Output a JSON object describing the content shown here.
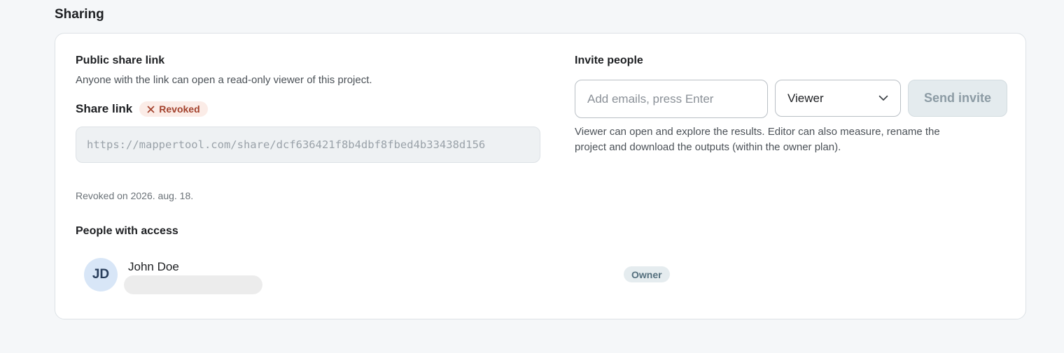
{
  "section": {
    "title": "Sharing"
  },
  "public_share": {
    "heading": "Public share link",
    "description": "Anyone with the link can open a read-only viewer of this project.",
    "share_link_label": "Share link",
    "status_badge": "Revoked",
    "status_icon": "close-icon",
    "url": "https://mappertool.com/share/dcf636421f8b4dbf8fbed4b33438d156",
    "revoked_note": "Revoked on 2026. aug. 18."
  },
  "people": {
    "heading": "People with access",
    "items": [
      {
        "initials": "JD",
        "name": "John Doe",
        "role": "Owner"
      }
    ]
  },
  "invite": {
    "heading": "Invite people",
    "email_placeholder": "Add emails, press Enter",
    "email_value": "",
    "role_selected": "Viewer",
    "role_icon": "chevron-down-icon",
    "send_label": "Send invite",
    "help_text": "Viewer can open and explore the results. Editor can also measure, rename the project and download the outputs (within the owner plan)."
  },
  "colors": {
    "background": "#f5f7f9",
    "card": "#ffffff",
    "revoked_badge_bg": "#fbece7",
    "revoked_badge_text": "#a3422d",
    "avatar_bg": "#d8e6f7",
    "owner_badge_bg": "#e5ecef",
    "send_button_bg": "#e4ebee"
  }
}
